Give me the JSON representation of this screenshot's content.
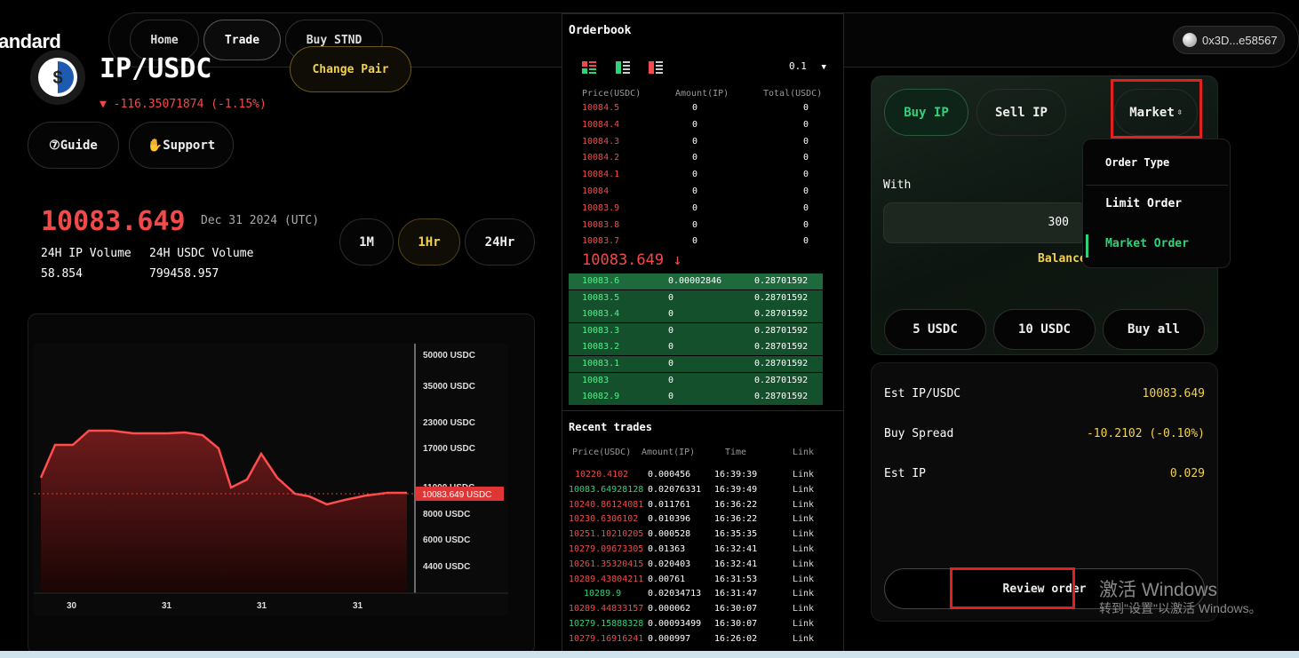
{
  "nav": {
    "brand": "andard",
    "home": "Home",
    "trade": "Trade",
    "buy_stnd": "Buy STND",
    "wallet": "0x3D...e58567"
  },
  "pair": {
    "title": "IP/USDC",
    "change": "▼ -116.35071874 (-1.15%)",
    "change_pair": "Change Pair",
    "guide": "⑦Guide",
    "support": "✋Support"
  },
  "stats": {
    "price": "10083.649",
    "date": "Dec 31 2024 (UTC)",
    "ip_volume_label": "24H IP Volume",
    "ip_volume": "58.854",
    "usdc_volume_label": "24H USDC Volume",
    "usdc_volume": "799458.957",
    "intervals": [
      "1M",
      "1Hr",
      "24Hr"
    ]
  },
  "chart_data": {
    "type": "area",
    "current_price_label": "10083.649 USDC",
    "y_ticks": [
      "50000 USDC",
      "35000 USDC",
      "23000 USDC",
      "17000 USDC",
      "11000 USDC",
      "8000 USDC",
      "6000 USDC",
      "4400 USDC"
    ],
    "x_ticks": [
      "30",
      "31",
      "31",
      "31"
    ],
    "colors": {
      "line": "#ff4d4d",
      "fill_top": "#6e1b1b",
      "fill_bottom": "#1a0505",
      "label_bg": "#e03535"
    }
  },
  "orderbook": {
    "title": "Orderbook",
    "tick": "0.1",
    "headers": [
      "Price(USDC)",
      "Amount(IP)",
      "Total(USDC)"
    ],
    "asks": [
      [
        "10084.5",
        "0",
        "0"
      ],
      [
        "10084.4",
        "0",
        "0"
      ],
      [
        "10084.3",
        "0",
        "0"
      ],
      [
        "10084.2",
        "0",
        "0"
      ],
      [
        "10084.1",
        "0",
        "0"
      ],
      [
        "10084",
        "0",
        "0"
      ],
      [
        "10083.9",
        "0",
        "0"
      ],
      [
        "10083.8",
        "0",
        "0"
      ],
      [
        "10083.7",
        "0",
        "0"
      ]
    ],
    "mid_price": "10083.649 ↓",
    "bids": [
      [
        "10083.6",
        "0.00002846",
        "0.28701592"
      ],
      [
        "10083.5",
        "0",
        "0.28701592"
      ],
      [
        "10083.4",
        "0",
        "0.28701592"
      ],
      [
        "10083.3",
        "0",
        "0.28701592"
      ],
      [
        "10083.2",
        "0",
        "0.28701592"
      ],
      [
        "10083.1",
        "0",
        "0.28701592"
      ],
      [
        "10083",
        "0",
        "0.28701592"
      ],
      [
        "10082.9",
        "0",
        "0.28701592"
      ]
    ]
  },
  "recent_trades": {
    "title": "Recent trades",
    "headers": [
      "Price(USDC)",
      "Amount(IP)",
      "Time",
      "Link"
    ],
    "rows": [
      {
        "price": "10220.4102",
        "amount": "0.000456",
        "time": "16:39:39",
        "link": "Link",
        "side": "sell"
      },
      {
        "price": "10083.64928128",
        "amount": "0.02076331",
        "time": "16:39:49",
        "link": "Link",
        "side": "buy"
      },
      {
        "price": "10240.86124081",
        "amount": "0.011761",
        "time": "16:36:22",
        "link": "Link",
        "side": "sell"
      },
      {
        "price": "10230.6306102",
        "amount": "0.010396",
        "time": "16:36:22",
        "link": "Link",
        "side": "sell"
      },
      {
        "price": "10251.10210205",
        "amount": "0.000528",
        "time": "16:35:35",
        "link": "Link",
        "side": "sell"
      },
      {
        "price": "10279.09673305",
        "amount": "0.01363",
        "time": "16:32:41",
        "link": "Link",
        "side": "sell"
      },
      {
        "price": "10261.35320415",
        "amount": "0.020403",
        "time": "16:32:41",
        "link": "Link",
        "side": "sell"
      },
      {
        "price": "10289.43804211",
        "amount": "0.00761",
        "time": "16:31:53",
        "link": "Link",
        "side": "sell"
      },
      {
        "price": "10289.9",
        "amount": "0.02034713",
        "time": "16:31:47",
        "link": "Link",
        "side": "buy"
      },
      {
        "price": "10289.44833157",
        "amount": "0.000062",
        "time": "16:30:07",
        "link": "Link",
        "side": "sell"
      },
      {
        "price": "10279.15888328",
        "amount": "0.00093499",
        "time": "16:30:07",
        "link": "Link",
        "side": "buy"
      },
      {
        "price": "10279.16916241",
        "amount": "0.000997",
        "time": "16:26:02",
        "link": "Link",
        "side": "sell"
      }
    ]
  },
  "order": {
    "buy_label": "Buy IP",
    "sell_label": "Sell IP",
    "type_selected": "Market",
    "with_label": "With",
    "amount_value": "300",
    "balance_label": "Balance",
    "quick": [
      "5 USDC",
      "10 USDC",
      "Buy all"
    ],
    "dropdown": {
      "header": "Order Type",
      "options": [
        "Limit Order",
        "Market Order"
      ],
      "selected": "Market Order"
    },
    "est_price_label": "Est IP/USDC",
    "est_price": "10083.649",
    "spread_label": "Buy Spread",
    "spread": "-10.2102 (-0.10%)",
    "est_ip_label": "Est IP",
    "est_ip": "0.029",
    "review": "Review order"
  },
  "watermark": {
    "line1": "激活 Windows",
    "line2": "转到\"设置\"以激活 Windows。"
  },
  "colors": {
    "accent_green": "#2fd27a",
    "accent_red": "#f24a4a",
    "gold": "#f2d24b"
  }
}
